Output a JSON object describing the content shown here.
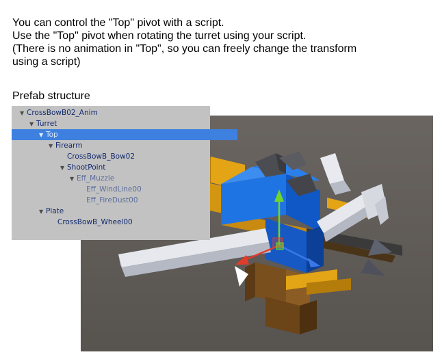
{
  "intro": {
    "line1": "You can control the \"Top\" pivot with a script.",
    "line2": "Use the \"Top\" pivot when rotating the turret using your script.",
    "line3": "(There is no animation in \"Top\", so you can freely change the transform",
    "line4": "using a script)"
  },
  "prefab_heading": "Prefab structure",
  "hierarchy": {
    "items": [
      {
        "label": "CrossBowB02_Anim",
        "expandable": true,
        "selected": false,
        "faded": false
      },
      {
        "label": "Turret",
        "expandable": true,
        "selected": false,
        "faded": false
      },
      {
        "label": "Top",
        "expandable": true,
        "selected": true,
        "faded": false
      },
      {
        "label": "Firearm",
        "expandable": true,
        "selected": false,
        "faded": false
      },
      {
        "label": "CrossBowB_Bow02",
        "expandable": false,
        "selected": false,
        "faded": false
      },
      {
        "label": "ShootPoint",
        "expandable": true,
        "selected": false,
        "faded": false
      },
      {
        "label": "Eff_Muzzle",
        "expandable": true,
        "selected": false,
        "faded": true
      },
      {
        "label": "Eff_WindLine00",
        "expandable": false,
        "selected": false,
        "faded": true
      },
      {
        "label": "Eff_FireDust00",
        "expandable": false,
        "selected": false,
        "faded": true
      },
      {
        "label": "Plate",
        "expandable": true,
        "selected": false,
        "faded": false
      },
      {
        "label": "CrossBowB_Wheel00",
        "expandable": false,
        "selected": false,
        "faded": false
      }
    ]
  },
  "icons": {
    "expanded_arrow": "triangle-down-icon"
  },
  "colors": {
    "selection": "#3d80df",
    "hierarchy_bg": "#c2c2c2",
    "item_text": "#122a6e",
    "viewport_bg": "#5e5a57",
    "turret_blue": "#1e6fe0",
    "frame_orange": "#e3a415",
    "bow_white": "#dfe2ea",
    "gizmo_y": "#6fd62b",
    "gizmo_x": "#e03c2c",
    "gizmo_z": "#3a78e8"
  }
}
